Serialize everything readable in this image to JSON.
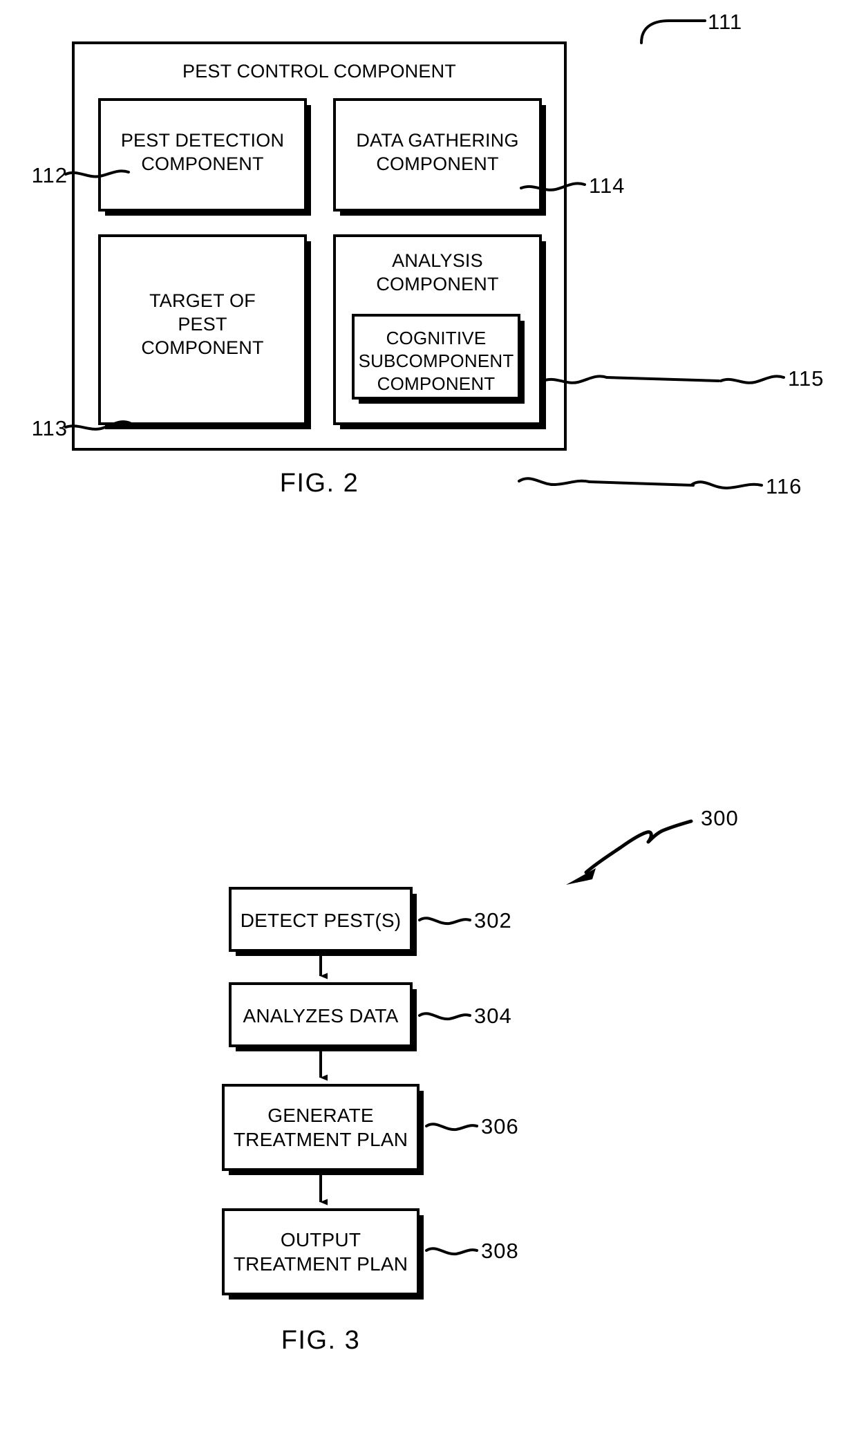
{
  "figure2": {
    "caption": "FIG. 2",
    "outer_box": {
      "title": "PEST CONTROL COMPONENT",
      "ref": "111"
    },
    "boxes": [
      {
        "label": "PEST DETECTION\nCOMPONENT",
        "ref": "112",
        "ref_side": "left"
      },
      {
        "label": "DATA GATHERING\nCOMPONENT",
        "ref": "114",
        "ref_side": "right"
      },
      {
        "label": "TARGET OF\nPEST\nCOMPONENT",
        "ref": "113",
        "ref_side": "left"
      },
      {
        "label": "ANALYSIS\nCOMPONENT",
        "ref": "115",
        "ref_side": "right"
      }
    ],
    "nested_box": {
      "label": "COGNITIVE\nSUBCOMPONENT\nCOMPONENT",
      "ref": "116",
      "ref_side": "right"
    }
  },
  "figure3": {
    "caption": "FIG. 3",
    "flow_ref": "300",
    "steps": [
      {
        "label": "DETECT PEST(S)",
        "ref": "302"
      },
      {
        "label": "ANALYZES DATA",
        "ref": "304"
      },
      {
        "label": "GENERATE\nTREATMENT PLAN",
        "ref": "306"
      },
      {
        "label": "OUTPUT\nTREATMENT PLAN",
        "ref": "308"
      }
    ]
  },
  "colors": {
    "ink": "#000000",
    "paper": "#ffffff"
  }
}
